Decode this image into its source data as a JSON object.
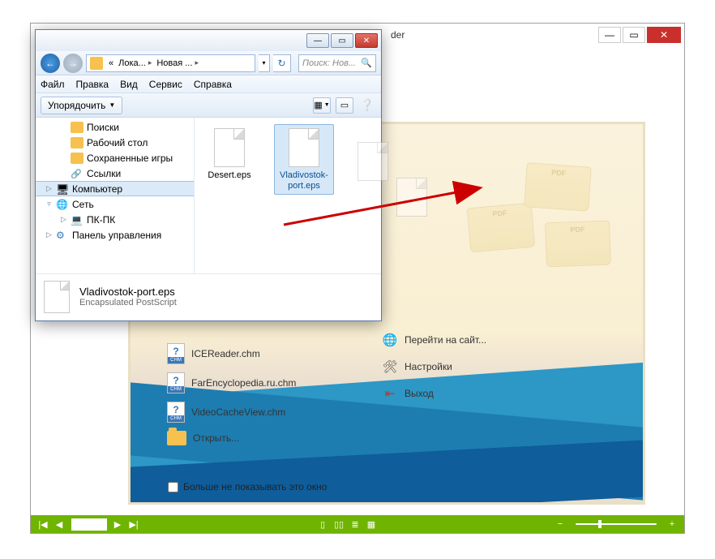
{
  "bg": {
    "title_suffix": "der",
    "left_items": {
      "ice": "ICEReader.chm",
      "far": "FarEncyclopedia.ru.chm",
      "vcv": "VideoCacheView.chm",
      "open": "Открыть..."
    },
    "right_items": {
      "site": "Перейти на сайт...",
      "settings": "Настройки",
      "exit": "Выход"
    },
    "dont_show": "Больше не показывать это окно",
    "toolbar": {
      "first": "|◀",
      "prev": "◀",
      "next": "▶",
      "last": "▶|",
      "zoom_out": "−",
      "zoom_in": "+"
    }
  },
  "fg": {
    "nav": {
      "crumb_pre": "«",
      "crumb1": "Лока...",
      "crumb2": "Новая ...",
      "search_ph": "Поиск: Нов..."
    },
    "menu": {
      "file": "Файл",
      "edit": "Правка",
      "view": "Вид",
      "tools": "Сервис",
      "help": "Справка"
    },
    "cmd": {
      "organize": "Упорядочить"
    },
    "tree": {
      "search": "Поиски",
      "desktop": "Рабочий стол",
      "saved": "Сохраненные игры",
      "links": "Ссылки",
      "computer": "Компьютер",
      "network": "Сеть",
      "pcpc": "ПК-ПК",
      "control": "Панель управления"
    },
    "files": {
      "desert": "Desert.eps",
      "vlad": "Vladivostok-port.eps"
    },
    "details": {
      "name": "Vladivostok-port.eps",
      "type": "Encapsulated PostScript"
    }
  }
}
